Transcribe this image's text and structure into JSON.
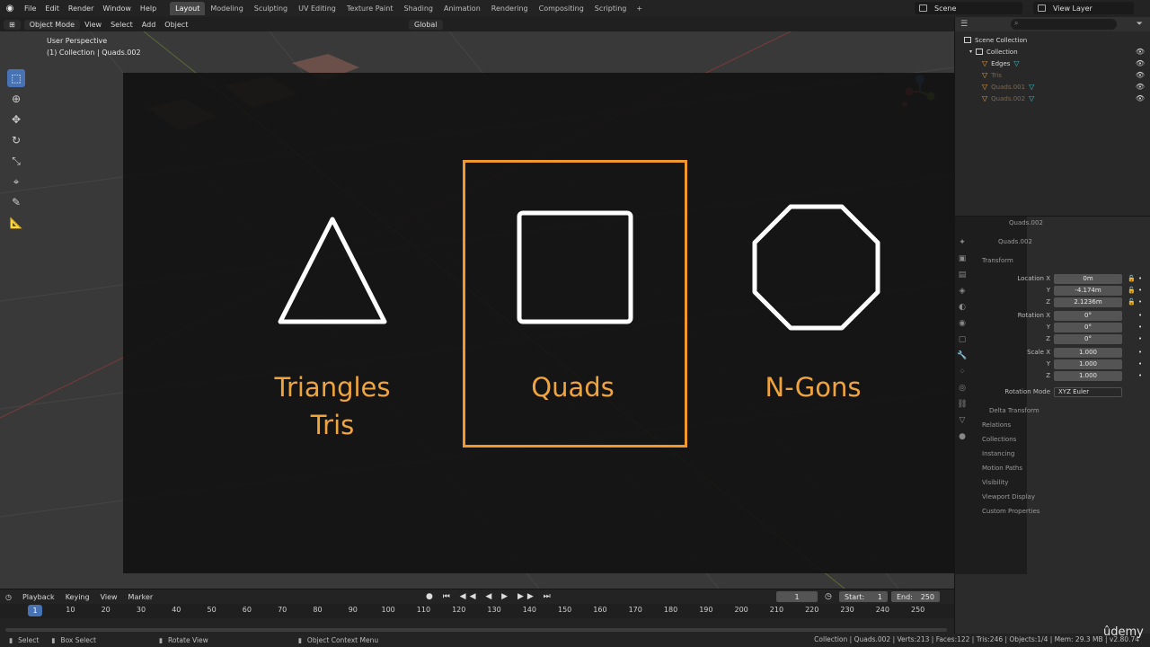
{
  "app": {
    "menu": [
      "File",
      "Edit",
      "Render",
      "Window",
      "Help"
    ],
    "workspaces": [
      "Layout",
      "Modeling",
      "Sculpting",
      "UV Editing",
      "Texture Paint",
      "Shading",
      "Animation",
      "Rendering",
      "Compositing",
      "Scripting"
    ],
    "active_workspace": "Layout",
    "add_workspace": "+",
    "scene": "Scene",
    "view_layer": "View Layer"
  },
  "viewport_header": {
    "mode": "Object Mode",
    "menus": [
      "View",
      "Select",
      "Add",
      "Object"
    ],
    "transform_orientation": "Global"
  },
  "viewport": {
    "perspective": "User Perspective",
    "context": "(1) Collection | Quads.002"
  },
  "slide": {
    "triangles_line1": "Triangles",
    "triangles_line2": "Tris",
    "quads": "Quads",
    "ngons": "N-Gons",
    "accent": "#f1982b",
    "text_color": "#f0a53c"
  },
  "outliner": {
    "scene_collection": "Scene Collection",
    "collection": "Collection",
    "items": [
      {
        "name": "Edges"
      },
      {
        "name": "Tris"
      },
      {
        "name": "Quads.001"
      },
      {
        "name": "Quads.002"
      }
    ]
  },
  "properties": {
    "object_name": "Quads.002",
    "object_name_field": "Quads.002",
    "transform_header": "Transform",
    "location_label": "Location X",
    "rotation_label": "Rotation X",
    "scale_label": "Scale X",
    "axis_y": "Y",
    "axis_z": "Z",
    "location": [
      "0m",
      "-4.174m",
      "2.1236m"
    ],
    "rotation": [
      "0°",
      "0°",
      "0°"
    ],
    "scale": [
      "1.000",
      "1.000",
      "1.000"
    ],
    "rotation_mode_label": "Rotation Mode",
    "rotation_mode": "XYZ Euler",
    "sections": [
      "Delta Transform",
      "Relations",
      "Collections",
      "Instancing",
      "Motion Paths",
      "Visibility",
      "Viewport Display",
      "Custom Properties"
    ]
  },
  "timeline": {
    "menus": [
      "Playback",
      "Keying",
      "View",
      "Marker"
    ],
    "current_frame": "1",
    "start_label": "Start:",
    "start": "1",
    "end_label": "End:",
    "end": "250",
    "playhead": "1",
    "ticks": [
      "10",
      "20",
      "30",
      "40",
      "50",
      "60",
      "70",
      "80",
      "90",
      "100",
      "110",
      "120",
      "130",
      "140",
      "150",
      "160",
      "170",
      "180",
      "190",
      "200",
      "210",
      "220",
      "230",
      "240",
      "250"
    ]
  },
  "status": {
    "select": "Select",
    "box_select": "Box Select",
    "rotate_view": "Rotate View",
    "context_menu": "Object Context Menu",
    "stats": "Collection | Quads.002 | Verts:213 | Faces:122 | Tris:246 | Objects:1/4 | Mem: 29.3 MB | v2.80.74"
  },
  "watermark": "ûdemy",
  "icons": [
    "blender-logo-icon",
    "select-box-icon",
    "cursor-icon",
    "move-icon",
    "rotate-icon",
    "scale-icon",
    "transform-icon",
    "annotate-icon",
    "measure-icon",
    "eye-icon",
    "search-icon",
    "mesh-icon",
    "play-icon"
  ]
}
